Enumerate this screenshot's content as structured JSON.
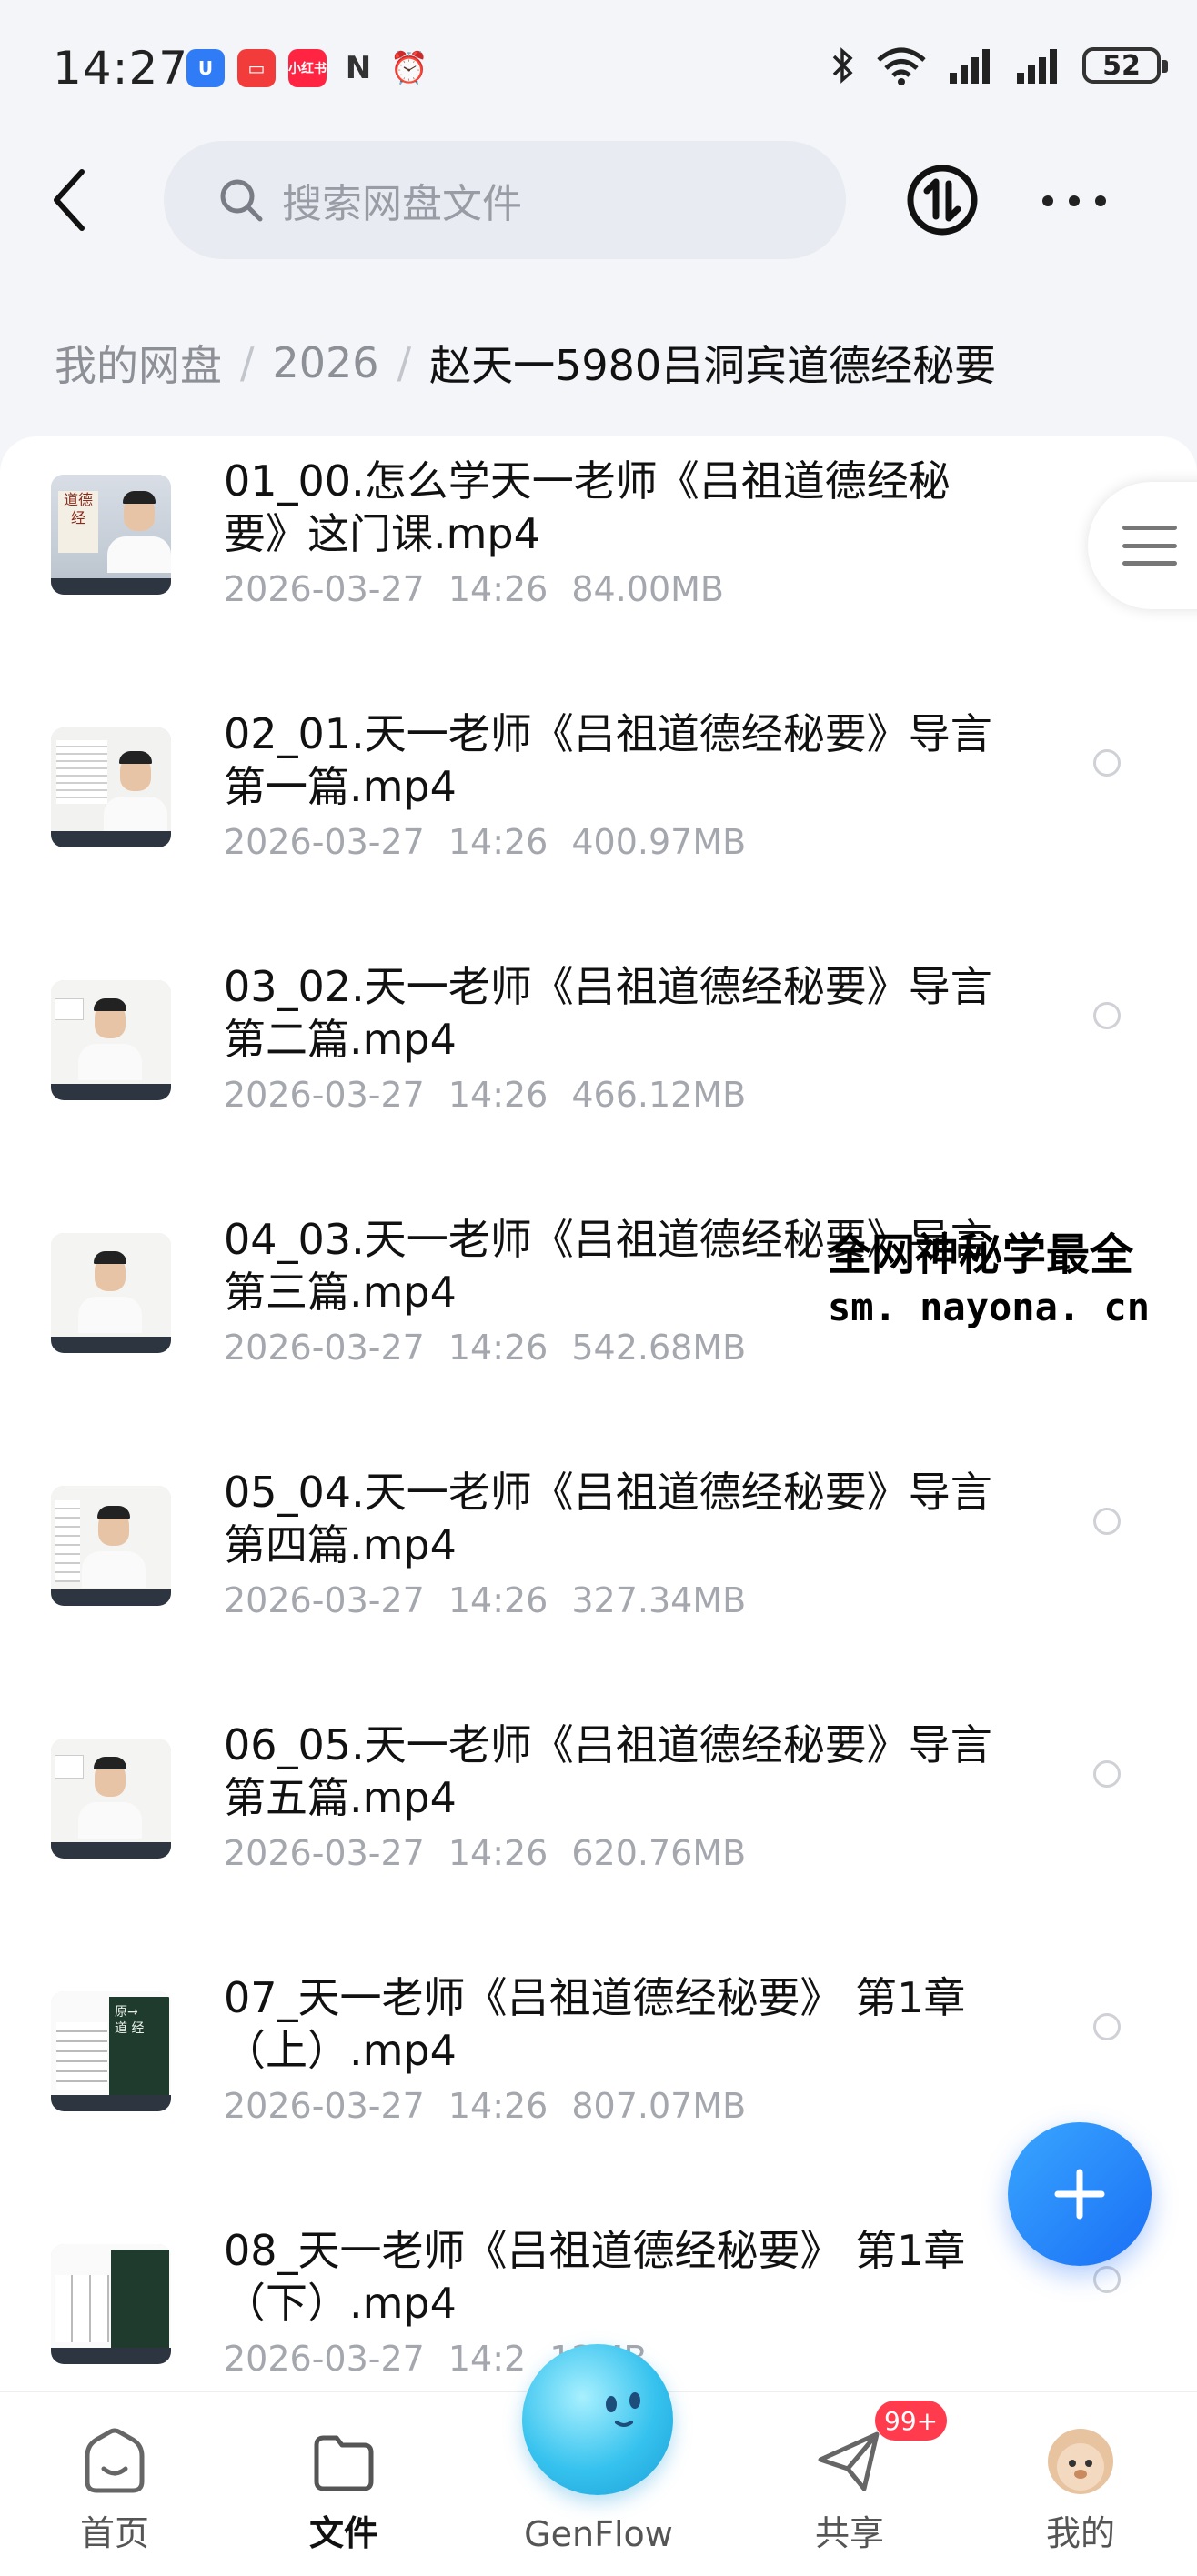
{
  "status_bar": {
    "time": "14:27",
    "battery": "52",
    "app_badge": "小红书"
  },
  "header": {
    "search_placeholder": "搜索网盘文件"
  },
  "breadcrumb": {
    "root": "我的网盘",
    "year": "2026",
    "current": "赵天一5980吕洞宾道德经秘要"
  },
  "files": [
    {
      "name": "01_00.怎么学天一老师《吕祖道德经秘要》这门课.mp4",
      "date": "2026-03-27",
      "time": "14:26",
      "size": "84.00MB"
    },
    {
      "name": "02_01.天一老师《吕祖道德经秘要》导言 第一篇.mp4",
      "date": "2026-03-27",
      "time": "14:26",
      "size": "400.97MB"
    },
    {
      "name": "03_02.天一老师《吕祖道德经秘要》导言 第二篇.mp4",
      "date": "2026-03-27",
      "time": "14:26",
      "size": "466.12MB"
    },
    {
      "name": "04_03.天一老师《吕祖道德经秘要》导言 第三篇.mp4",
      "date": "2026-03-27",
      "time": "14:26",
      "size": "542.68MB"
    },
    {
      "name": "05_04.天一老师《吕祖道德经秘要》导言 第四篇.mp4",
      "date": "2026-03-27",
      "time": "14:26",
      "size": "327.34MB"
    },
    {
      "name": "06_05.天一老师《吕祖道德经秘要》导言 第五篇.mp4",
      "date": "2026-03-27",
      "time": "14:26",
      "size": "620.76MB"
    },
    {
      "name": "07_天一老师《吕祖道德经秘要》 第1章（上）.mp4",
      "date": "2026-03-27",
      "time": "14:26",
      "size": "807.07MB"
    },
    {
      "name": "08_天一老师《吕祖道德经秘要》 第1章（下）.mp4",
      "date": "2026-03-27",
      "time": "14:2",
      "size": "12MB"
    }
  ],
  "watermark": {
    "line1": "全网神秘学最全",
    "line2": "sm. nayona. cn"
  },
  "bottom_nav": {
    "home": "首页",
    "files": "文件",
    "genflow": "GenFlow",
    "share": "共享",
    "share_badge": "99+",
    "me": "我的"
  },
  "colors": {
    "accent": "#1a6ff5",
    "badge": "#ff3b4d"
  }
}
